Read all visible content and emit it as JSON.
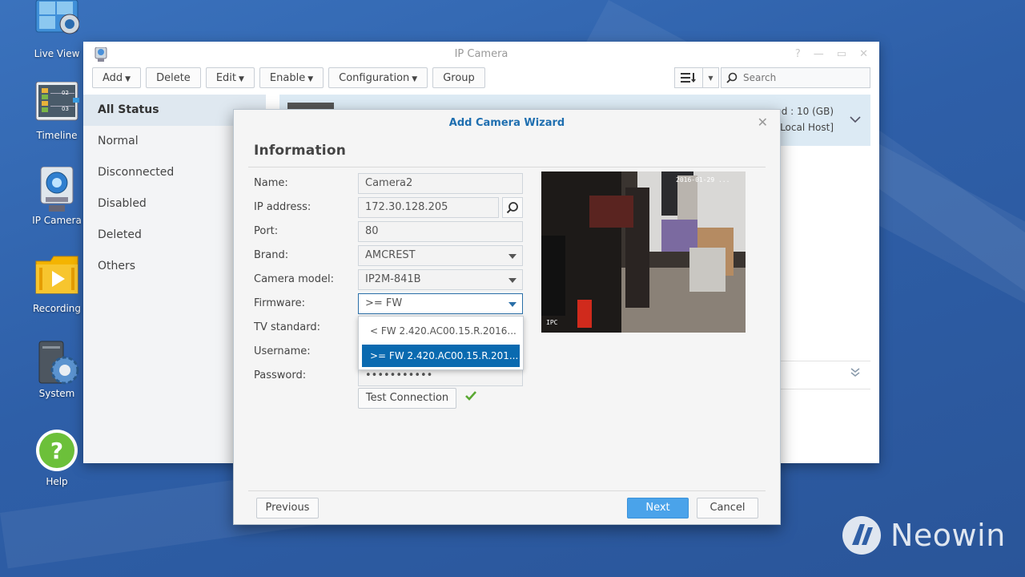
{
  "desktop": {
    "icons": [
      {
        "label": "Live View"
      },
      {
        "label": "Timeline"
      },
      {
        "label": "IP Camera"
      },
      {
        "label": "Recording"
      },
      {
        "label": "System"
      },
      {
        "label": "Help"
      }
    ],
    "timeline_numbers": [
      "02",
      "03"
    ],
    "watermark": "Neowin"
  },
  "window": {
    "title": "IP Camera",
    "toolbar": {
      "add": "Add",
      "delete": "Delete",
      "edit": "Edit",
      "enable": "Enable",
      "configuration": "Configuration",
      "group": "Group"
    },
    "search_placeholder": "Search",
    "sidebar": [
      "All Status",
      "Normal",
      "Disconnected",
      "Disabled",
      "Deleted",
      "Others"
    ],
    "camera_row": {
      "line1": "ed : 10 (GB)",
      "line2": "Local Host]"
    }
  },
  "wizard": {
    "title": "Add Camera Wizard",
    "heading": "Information",
    "labels": {
      "name": "Name:",
      "ip": "IP address:",
      "port": "Port:",
      "brand": "Brand:",
      "model": "Camera model:",
      "firmware": "Firmware:",
      "tv": "TV standard:",
      "username": "Username:",
      "password": "Password:"
    },
    "values": {
      "name": "Camera2",
      "ip": "172.30.128.205",
      "port": "80",
      "brand": "AMCREST",
      "model": "IP2M-841B",
      "firmware": ">= FW 2.420.AC00.15.R.20...",
      "password": "•••••••••••"
    },
    "firmware_options": [
      "< FW 2.420.AC00.15.R.2016...",
      ">= FW 2.420.AC00.15.R.201..."
    ],
    "preview": {
      "timestamp": "2016-01-29 ...",
      "osd": "IPC"
    },
    "buttons": {
      "test": "Test Connection",
      "previous": "Previous",
      "next": "Next",
      "cancel": "Cancel"
    },
    "colors": {
      "accent": "#1f6fb0",
      "selected": "#0a6ab0",
      "next_button": "#4aa3ea",
      "success": "#5aa832"
    }
  }
}
